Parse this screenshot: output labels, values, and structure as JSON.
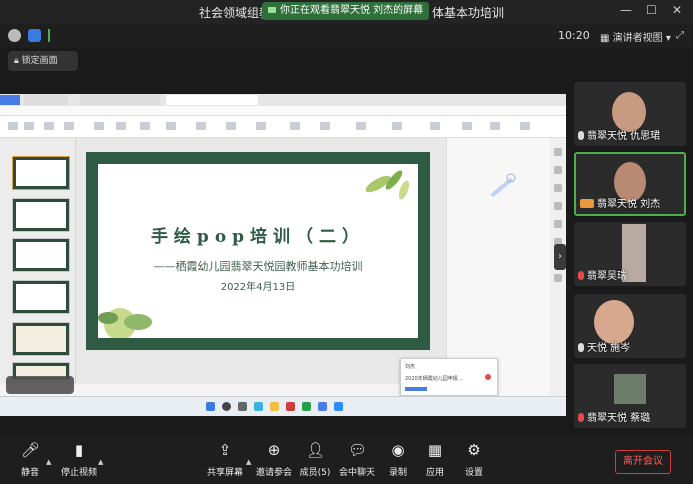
{
  "title": {
    "left": "社会领域组教",
    "right": "体基本功培训"
  },
  "share_banner": "你正在观看翡翠天悦  刘杰的屏幕",
  "clock": "10:20",
  "view_button": "演讲者视图",
  "lock_button": "锁定画面",
  "slide": {
    "title": "手绘pop培训（二）",
    "subtitle": "——栖霞幼儿园翡翠天悦园教师基本功培训",
    "date": "2022年4月13日"
  },
  "popup": {
    "name": "刘杰",
    "file": "2020年栖霞幼儿园申报..."
  },
  "participants": [
    {
      "name": "翡翠天悦  仇思珺",
      "mic": "on",
      "active": false
    },
    {
      "name": "翡翠天悦  刘杰",
      "mic": "active",
      "active": true
    },
    {
      "name": "翡翠吴瑞",
      "mic": "off",
      "active": false
    },
    {
      "name": "天悦  施岑",
      "mic": "on",
      "active": false
    },
    {
      "name": "翡翠天悦  蔡璐",
      "mic": "off",
      "active": false
    }
  ],
  "controls": {
    "mute": "静音",
    "stop_video": "停止视频",
    "share": "共享屏幕",
    "invite": "邀请参会",
    "members": "成员(5)",
    "chat": "会中聊天",
    "record": "录制",
    "apps": "应用",
    "settings": "设置",
    "leave": "离开会议"
  },
  "icons": [
    "info-icon",
    "shield-icon",
    "signal-icon",
    "minimize-icon",
    "maximize-icon",
    "close-icon",
    "lock-icon",
    "mic-icon",
    "video-icon",
    "share-screen-icon",
    "invite-icon",
    "members-icon",
    "chat-icon",
    "record-icon",
    "apps-icon",
    "settings-icon"
  ],
  "colors": {
    "accent_green": "#4caf50",
    "leave_red": "#d13b3b",
    "slide_green": "#2f5a44"
  }
}
